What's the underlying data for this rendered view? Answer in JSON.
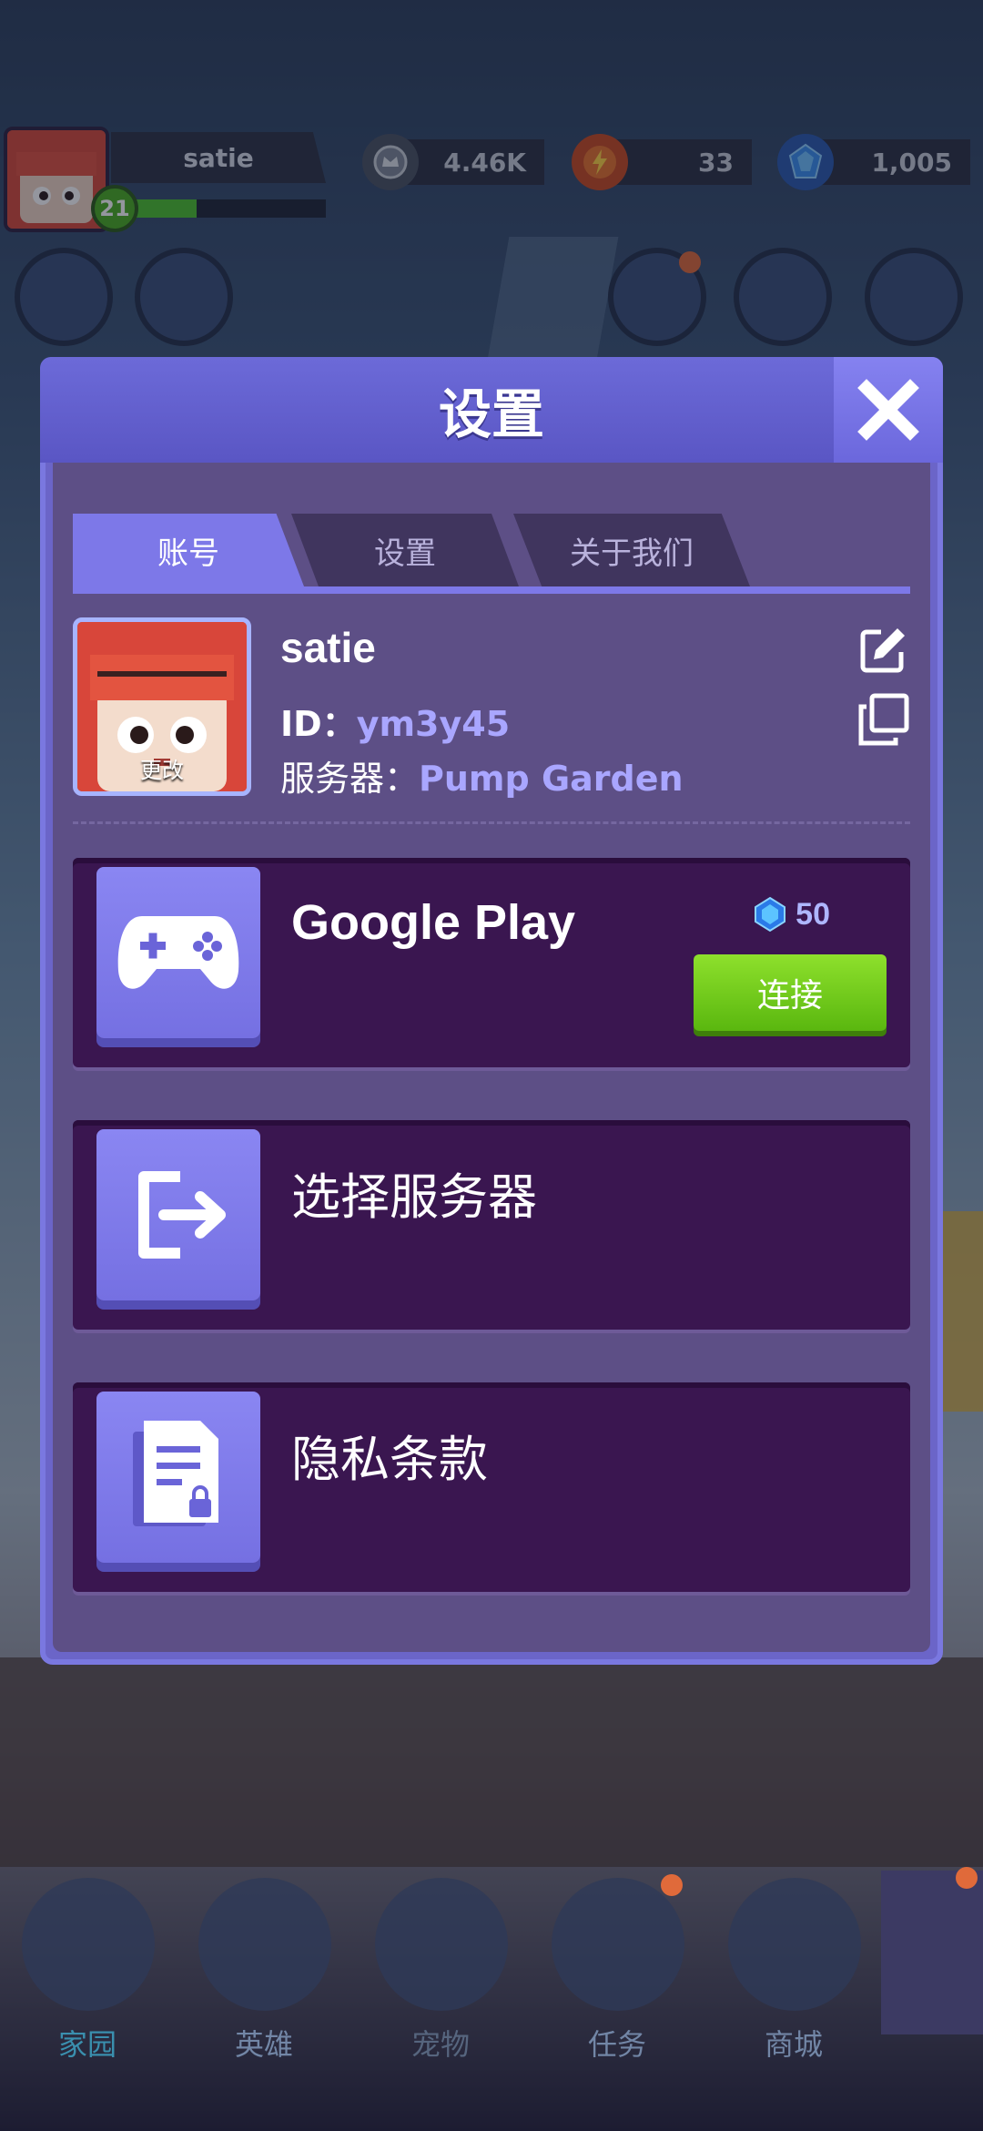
{
  "hud": {
    "player_name": "satie",
    "level": "21",
    "xp_fraction": 0.35,
    "resources": [
      {
        "icon": "crown-coin-icon",
        "value": "4.46K"
      },
      {
        "icon": "energy-icon",
        "value": "33"
      },
      {
        "icon": "blue-gem-icon",
        "value": "1,005"
      }
    ]
  },
  "dialog": {
    "title": "设置",
    "tabs": [
      "账号",
      "设置",
      "关于我们"
    ],
    "active_tab": 0,
    "profile": {
      "name": "satie",
      "avatar_action": "更改",
      "id_label": "ID：",
      "id_value": "ym3y45",
      "server_label": "服务器：",
      "server_value": "Pump Garden"
    },
    "cards": {
      "google": {
        "title": "Google Play",
        "reward": "50",
        "button": "连接"
      },
      "server": {
        "title": "选择服务器"
      },
      "privacy": {
        "title": "隐私条款"
      }
    }
  },
  "nav": {
    "items": [
      "家园",
      "英雄",
      "宠物",
      "任务",
      "商城"
    ],
    "active": 0
  },
  "colors": {
    "dialog_accent": "#6b65c8",
    "card_bg": "#3a1650",
    "connect_green": "#6bc61a",
    "highlight_text": "#a9a6ff"
  }
}
